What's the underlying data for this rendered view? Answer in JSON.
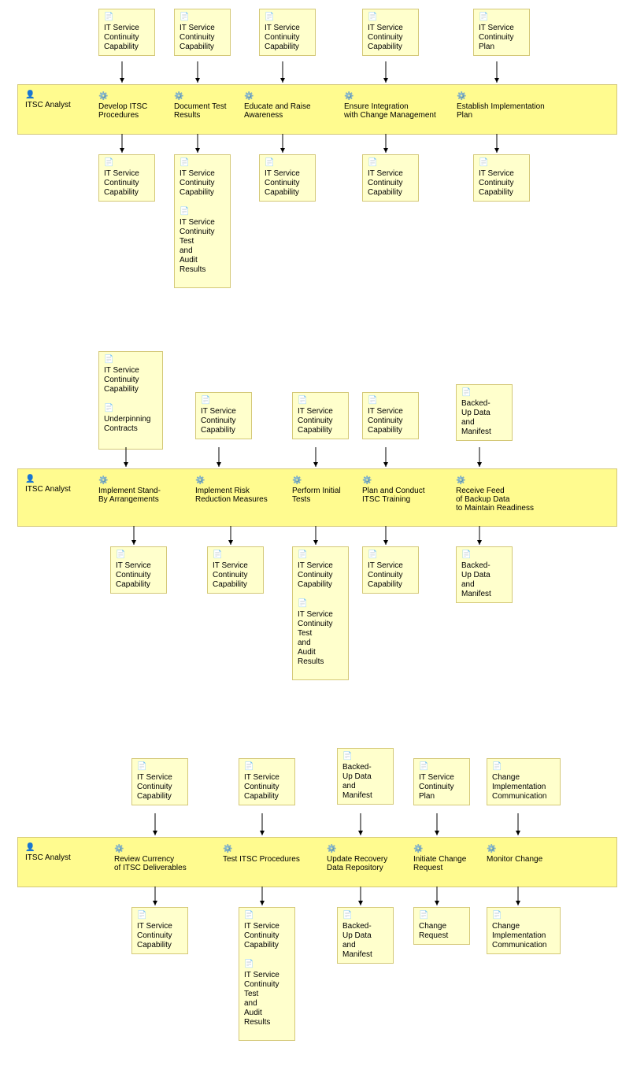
{
  "role": "ITSC Analyst",
  "artifacts": {
    "cap": "IT Service\nContinuity\nCapability",
    "plan": "IT Service\nContinuity\nPlan",
    "testaudit": "IT Service\nContinuity\nTest\nand\nAudit\nResults",
    "underpin": "Underpinning\nContracts",
    "backup": "Backed-\nUp Data\nand\nManifest",
    "changecomm": "Change\nImplementation\nCommunication",
    "changereq": "Change\nRequest"
  },
  "activities": {
    "a1": "Develop ITSC\nProcedures",
    "a2": "Document Test\nResults",
    "a3": "Educate and Raise\nAwareness",
    "a4": "Ensure Integration\nwith Change Management",
    "a5": "Establish Implementation\nPlan",
    "b1": "Implement Stand-\nBy Arrangements",
    "b2": "Implement Risk\nReduction Measures",
    "b3": "Perform Initial\nTests",
    "b4": "Plan and Conduct\nITSC Training",
    "b5": "Receive Feed\nof Backup Data\nto Maintain Readiness",
    "c1": "Review Currency\nof ITSC Deliverables",
    "c2": "Test ITSC Procedures",
    "c3": "Update Recovery\nData Repository",
    "c4": "Initiate Change\nRequest",
    "c5": "Monitor Change"
  }
}
